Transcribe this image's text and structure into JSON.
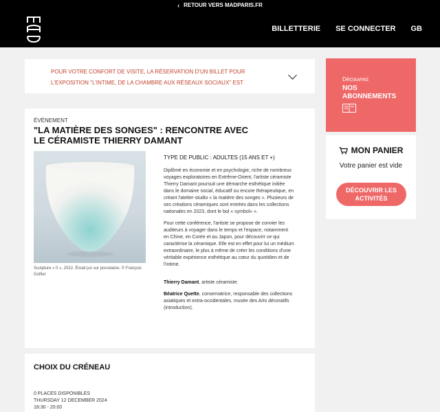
{
  "topbar": {
    "back_label": "RETOUR VERS MADPARIS.FR"
  },
  "header": {
    "nav": {
      "billetterie": "BILLETTERIE",
      "connect": "SE CONNECTER",
      "lang": "GB"
    }
  },
  "notice": {
    "text": "POUR VOTRE CONFORT DE VISITE, LA RÉSERVATION D'UN BILLET POUR L'EXPOSITION \"L'INTIME, DE LA CHAMBRE AUX RÉSEAUX SOCIAUX\" EST"
  },
  "subscriptions": {
    "small": "Découvrez",
    "big": "NOS ABONNEMENTS"
  },
  "cart": {
    "title": "MON PANIER",
    "empty": "Votre panier est vide",
    "button": "DÉCOUVRIR LES ACTIVITÉS"
  },
  "event": {
    "kicker": "ÉVÉNEMENT",
    "title": "\"LA MATIÈRE DES SONGES\" : RENCONTRE AVEC LE CÉRAMISTE THIERRY DAMANT",
    "caption": "Sculpture « 0 », 2022. Émail jun sur porcelaine. © François Golfier",
    "public": "TYPE DE PUBLIC : ADULTES (15 ANS ET +)",
    "para1": "Diplômé en économie et en psychologie, riche de nombreux voyages exploratoires en Extrême-Orient, l'artiste céramiste Thierry Damant poursuit une démarche esthétique initiée dans le domaine social, éducatif ou encore thérapeutique, en créant l'atelier-studio « la matière des songes ». Plusieurs de ses créations céramiques sont entrées dans les collections nationales en 2023, dont le bol « symbol» ».",
    "para2": "Pour cette conférence, l'artiste se propose de convier les auditeurs à voyager dans le temps et l'espace, notamment en Chine, en Corée et au Japon, pour découvrir ce qui caractérise la céramique. Elle est en effet pour lui un médium extraordinaire, le plus à même de créer les conditions d'une véritable expérience esthétique au cœur du quotidien et de l'intime.",
    "person1_name": "Thierry Damant",
    "person1_role": ", artiste céramiste.",
    "person2_name": "Béatrice Quette",
    "person2_role": ", conservatrice, responsable des collections asiatiques et extra-occidentales, musée des Arts décoratifs (introduction)."
  },
  "slots": {
    "title": "CHOIX DU CRÉNEAU",
    "places": "0 PLACES DISPONIBLES",
    "date": "THURSDAY 12 DECEMBER 2024",
    "time": "18:30 - 20:00"
  },
  "colors": {
    "accent": "#ef6868",
    "notice_text": "#c2412d",
    "header_bg": "#000000"
  }
}
